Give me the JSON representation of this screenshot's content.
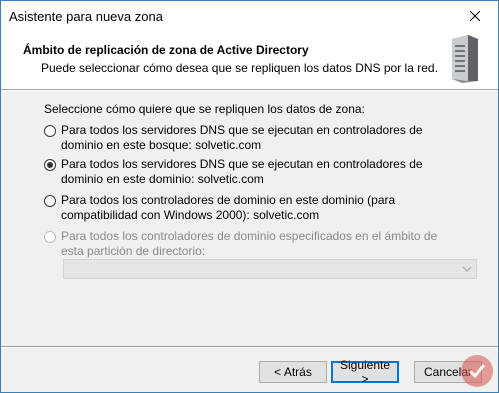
{
  "window": {
    "title": "Asistente para nueva zona"
  },
  "header": {
    "title": "Ámbito de replicación de zona de Active Directory",
    "subtitle": "Puede seleccionar cómo desea que se repliquen los datos DNS por la red."
  },
  "content": {
    "prompt": "Seleccione cómo quiere que se repliquen los datos de zona:",
    "options": [
      {
        "label": "Para todos los servidores DNS que se ejecutan en controladores de dominio en este bosque: solvetic.com",
        "checked": false,
        "enabled": true
      },
      {
        "label": "Para todos los servidores DNS que se ejecutan en controladores de dominio en este dominio: solvetic.com",
        "checked": true,
        "enabled": true
      },
      {
        "label": "Para todos los controladores de dominio en este dominio (para compatibilidad con Windows 2000): solvetic.com",
        "checked": false,
        "enabled": true
      },
      {
        "label": "Para todos los controladores de dominio especificados en el ámbito de esta partición de directorio:",
        "checked": false,
        "enabled": false
      }
    ],
    "partition_select_value": ""
  },
  "buttons": {
    "back": "< Atrás",
    "next": "Siguiente >",
    "cancel": "Cancelar"
  }
}
